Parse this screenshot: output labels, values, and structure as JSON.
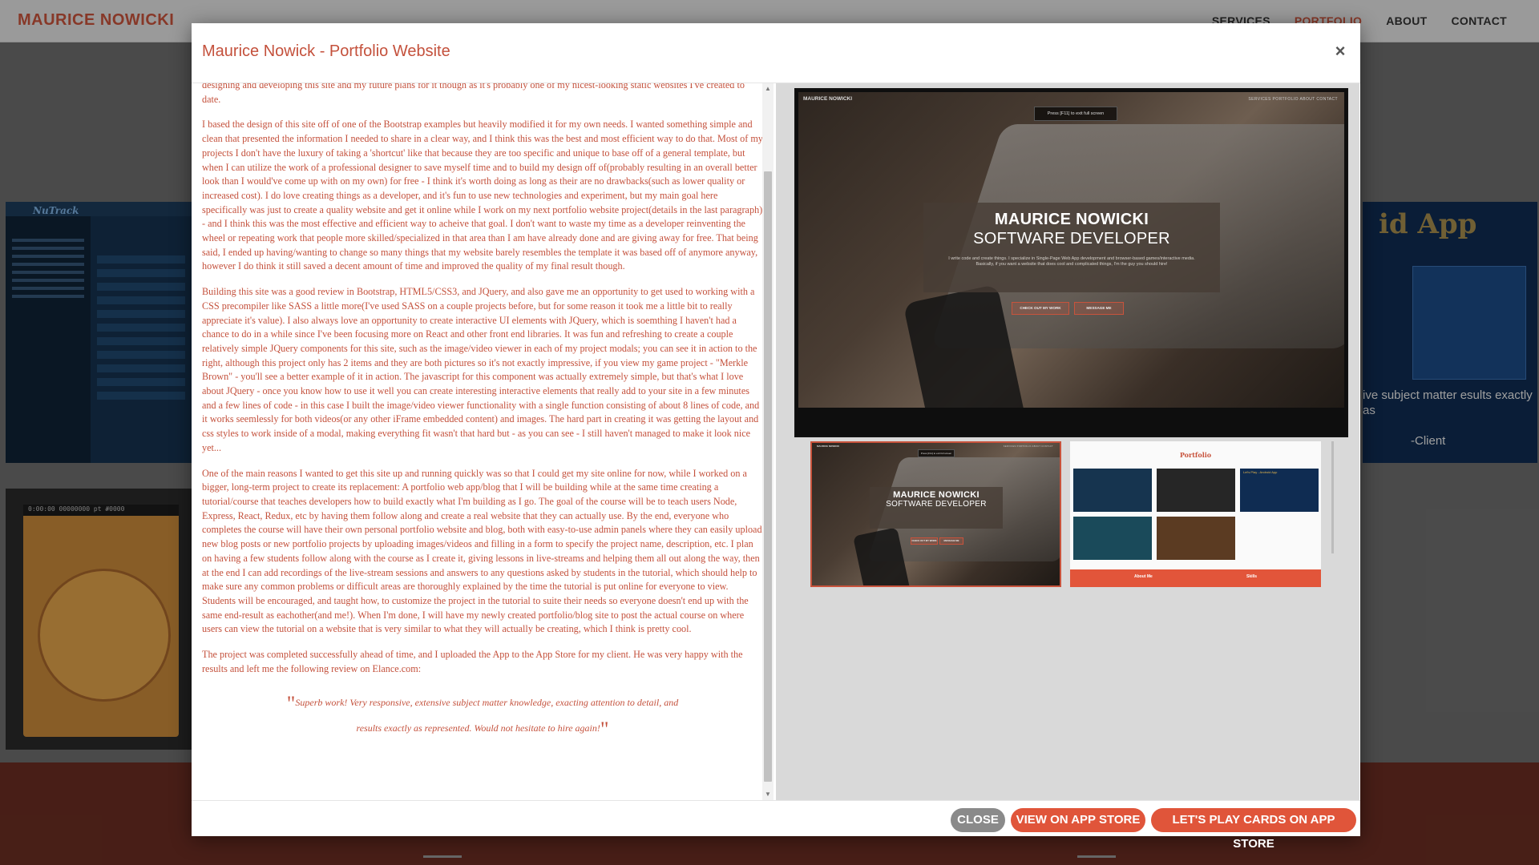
{
  "page": {
    "brand": "MAURICE NOWICKI",
    "nav": [
      "SERVICES",
      "PORTFOLIO",
      "ABOUT",
      "CONTACT"
    ],
    "active_nav": "PORTFOLIO",
    "bg_tiles": {
      "tracker_logo": "NuTrack",
      "game_status": "0:00:00  00000000  pt #0000",
      "android_title": "id App",
      "android_quote": "ive subject matter esults exactly as",
      "android_client": "-Client"
    }
  },
  "modal": {
    "title": "Maurice Nowick - Portfolio Website",
    "close_symbol": "×",
    "paragraphs": [
      "designing and developing this site and my future plans for it though as it's probably one of my nicest-looking static websites I've created to date.",
      "I based the design of this site off of one of the Bootstrap examples but heavily modified it for my own needs. I wanted something simple and clean that presented the information I needed to share in a clear way, and I think this was the best and most efficient way to do that. Most of my projects I don't have the luxury of taking a 'shortcut' like that because they are too specific and unique to base off of a general template, but when I can utilize the work of a professional designer to save myself time and to build my design off of(probably resulting in an overall better look than I would've come up with on my own) for free - I think it's worth doing as long as their are no drawbacks(such as lower quality or increased cost). I do love creating things as a developer, and it's fun to use new technologies and experiment, but my main goal here specifically was just to create a quality website and get it online while I work on my next portfolio website project(details in the last paragraph) - and I think this was the most effective and efficient way to acheive that goal. I don't want to waste my time as a developer reinventing the wheel or repeating work that people more skilled/specialized in that area than I am have already done and are giving away for free. That being said, I ended up having/wanting to change so many things that my website barely resembles the template it was based off of anymore anyway, however I do think it still saved a decent amount of time and improved the quality of my final result though.",
      "Building this site was a good review in Bootstrap, HTML5/CSS3, and JQuery, and also gave me an opportunity to get used to working with a CSS precompiler like SASS a little more(I've used SASS on a couple projects before, but for some reason it took me a little bit to really appreciate it's value). I also always love an opportunity to create interactive UI elements with JQuery, which is soemthing I haven't had a chance to do in a while since I've been focusing more on React and other front end libraries. It was fun and refreshing to create a couple relatively simple JQuery components for this site, such as the image/video viewer in each of my project modals; you can see it in action to the right, although this project only has 2 items and they are both pictures so it's not exactly impressive, if you view my game project - \"Merkle Brown\" - you'll see a better example of it in action. The javascript for this component was actually extremely simple, but that's what I love about JQuery - once you know how to use it well you can create interesting interactive elements that really add to your site in a few minutes and a few lines of code - in this case I built the image/video viewer functionality with a single function consisting of about 8 lines of code, and it works seemlessly for both videos(or any other iFrame embedded content) and images. The hard part in creating it was getting the layout and css styles to work inside of a modal, making everything fit wasn't that hard but - as you can see - I still haven't managed to make it look nice yet...",
      "One of the main reasons I wanted to get this site up and running quickly was so that I could get my site online for now, while I worked on a bigger, long-term project to create its replacement: A portfolio web app/blog that I will be building while at the same time creating a tutorial/course that teaches developers how to build exactly what I'm building as I go. The goal of the course will be to teach users Node, Express, React, Redux, etc by having them follow along and create a real website that they can actually use. By the end, everyone who completes the course will have their own personal portfolio website and blog, both with easy-to-use admin panels where they can easily upload new blog posts or new portfolio projects by uploading images/videos and filling in a form to specify the project name, description, etc. I plan on having a few students follow along with the course as I create it, giving lessons in live-streams and helping them all out along the way, then at the end I can add recordings of the live-stream sessions and answers to any questions asked by students in the tutorial, which should help to make sure any common problems or difficult areas are thoroughly explained by the time the tutorial is put online for everyone to view. Students will be encouraged, and taught how, to customize the project in the tutorial to suite their needs so everyone doesn't end up with the same end-result as eachother(and me!). When I'm done, I will have my newly created portfolio/blog site to post the actual course on where users can view the tutorial on a website that is very similar to what they will actually be creating, which I think is pretty cool.",
      "The project was completed successfully ahead of time, and I uploaded the App to the App Store for my client. He was very happy with the results and left me the following review on Elance.com:"
    ],
    "review_line1": "Superb work! Very responsive, extensive subject matter knowledge, exacting attention to detail, and",
    "review_line2": "results exactly as represented. Would not hesitate to hire again!",
    "viewer": {
      "main": {
        "nav_brand": "MAURICE NOWICKI",
        "nav_links": "SERVICES   PORTFOLIO   ABOUT   CONTACT",
        "esc_hint": "Press [F11] to exit full screen",
        "hero_name": "MAURICE NOWICKI",
        "hero_role": "SOFTWARE DEVELOPER",
        "hero_text": "I write code and create things. I specialize in Single-Page Web App development and browser-based games/interactive media. Basically, if you want a website that does cool and complicated things, I'm the guy you should hire!",
        "btn_work": "CHECK OUT MY WORK",
        "btn_msg": "MESSAGE ME"
      },
      "thumb2": {
        "title": "Portfolio",
        "bar_left": "About Me",
        "bar_right": "Skills",
        "card_text": "Let's Play - Android App"
      }
    }
  },
  "footer": {
    "close": "CLOSE",
    "app_store": "VIEW ON APP STORE",
    "cards": "LET'S PLAY CARDS ON APP STORE"
  }
}
